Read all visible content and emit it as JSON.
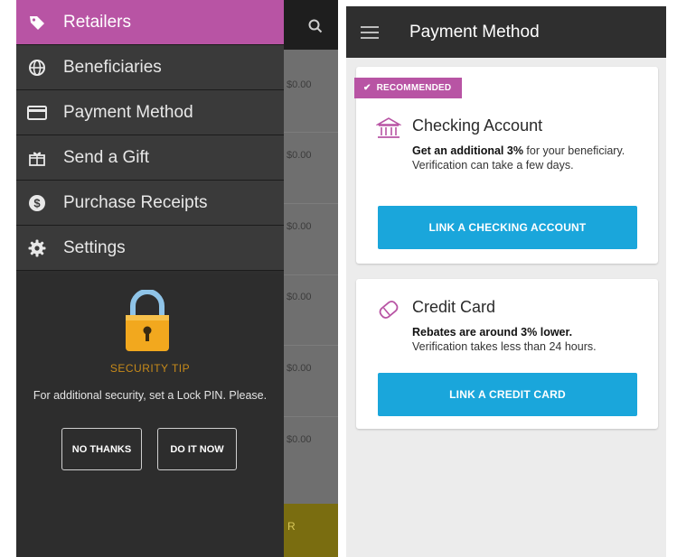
{
  "drawer": {
    "items": [
      {
        "label": "Retailers",
        "icon": "tag-icon",
        "active": true
      },
      {
        "label": "Beneficiaries",
        "icon": "globe-icon"
      },
      {
        "label": "Payment Method",
        "icon": "credit-card-icon"
      },
      {
        "label": "Send a Gift",
        "icon": "gift-icon"
      },
      {
        "label": "Purchase Receipts",
        "icon": "dollar-icon"
      },
      {
        "label": "Settings",
        "icon": "gear-icon"
      }
    ],
    "security_tip": {
      "title": "SECURITY TIP",
      "text": "For additional security, set a Lock PIN. Please.",
      "no_thanks": "NO THANKS",
      "do_it_now": "DO IT NOW"
    }
  },
  "background_app": {
    "prices": [
      "$0.00",
      "$0.00",
      "$0.00",
      "$0.00",
      "$0.00",
      "$0.00"
    ],
    "bottom_label": "R"
  },
  "payment": {
    "title": "Payment Method",
    "checking": {
      "badge": "RECOMMENDED",
      "title": "Checking Account",
      "desc_bold": "Get an additional 3%",
      "desc_rest": " for your beneficiary. Verification can take a few days.",
      "button": "LINK A CHECKING ACCOUNT"
    },
    "credit": {
      "title": "Credit Card",
      "desc_bold": "Rebates are around 3% lower.",
      "desc_rest": "Verification takes less than 24 hours.",
      "button": "LINK A CREDIT CARD"
    }
  },
  "colors": {
    "accent": "#b854a4",
    "button_blue": "#1aa6db",
    "tip_gold": "#c78a1a"
  }
}
